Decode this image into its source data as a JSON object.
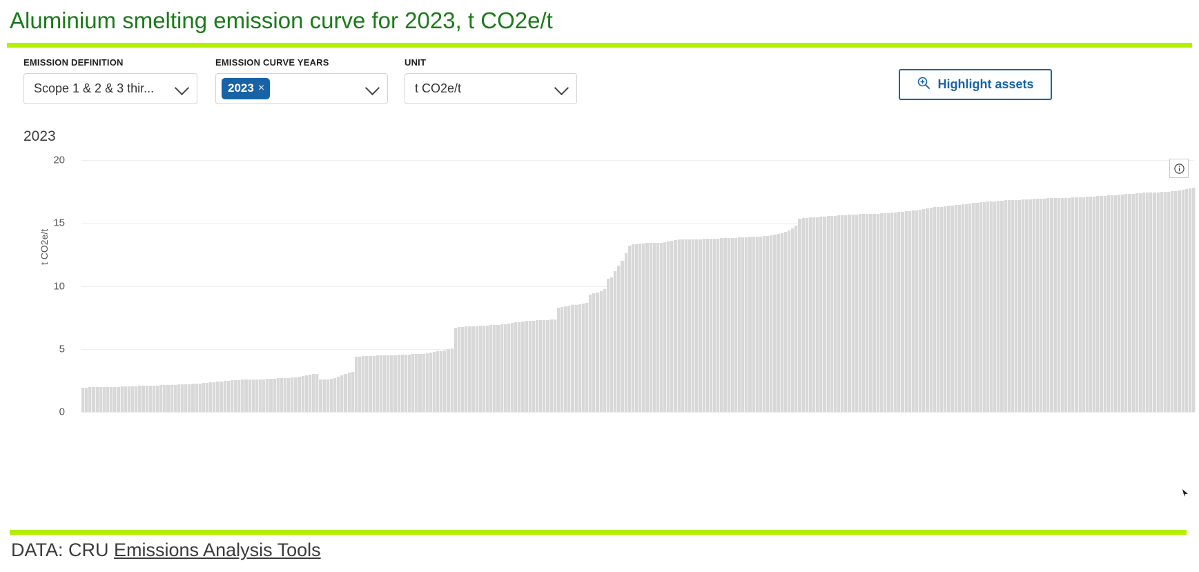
{
  "header": {
    "title": "Aluminium smelting emission curve for 2023, t CO2e/t",
    "title_color": "#1a7a1a",
    "rule_color": "#b2ef00"
  },
  "controls": {
    "emission_definition": {
      "label": "EMISSION DEFINITION",
      "value": "Scope 1 & 2 & 3 thir...",
      "chevron_icon": "chevron-down-icon"
    },
    "emission_curve_years": {
      "label": "EMISSION CURVE YEARS",
      "chip": "2023",
      "chip_remove": "×",
      "chip_color": "#1763a6",
      "chevron_icon": "chevron-down-icon"
    },
    "unit": {
      "label": "UNIT",
      "value": "t CO2e/t",
      "chevron_icon": "chevron-down-icon"
    },
    "highlight_button": {
      "label": "Highlight assets",
      "icon": "zoom-in-icon",
      "accent": "#1763a6"
    }
  },
  "chart_panel": {
    "subtitle": "2023",
    "info_icon": "info-icon"
  },
  "footer": {
    "prefix": "DATA: CRU ",
    "link": "Emissions Analysis Tools"
  },
  "chart_data": {
    "type": "bar",
    "title": "2023",
    "xlabel": "",
    "ylabel": "t CO2e/t",
    "ylim": [
      0,
      20
    ],
    "yticks": [
      0,
      5,
      10,
      15,
      20
    ],
    "grid": true,
    "legend": null,
    "bar_color": "#d8d8d8",
    "description": "Sorted ascending aluminium smelting emission intensity curve; each bar is one smelter asset.",
    "categories": [],
    "values": [
      1.9,
      1.9,
      1.95,
      1.95,
      1.95,
      2.0,
      2.0,
      2.0,
      2.0,
      2.0,
      2.0,
      2.05,
      2.05,
      2.05,
      2.05,
      2.05,
      2.1,
      2.1,
      2.1,
      2.1,
      2.1,
      2.1,
      2.15,
      2.15,
      2.15,
      2.15,
      2.15,
      2.2,
      2.2,
      2.2,
      2.2,
      2.25,
      2.25,
      2.25,
      2.3,
      2.3,
      2.35,
      2.35,
      2.4,
      2.4,
      2.45,
      2.45,
      2.5,
      2.5,
      2.5,
      2.55,
      2.55,
      2.55,
      2.6,
      2.6,
      2.6,
      2.6,
      2.65,
      2.65,
      2.65,
      2.7,
      2.7,
      2.7,
      2.7,
      2.75,
      2.75,
      2.8,
      2.85,
      2.9,
      2.95,
      3.0,
      3.0,
      2.6,
      2.6,
      2.6,
      2.65,
      2.7,
      2.8,
      2.9,
      3.0,
      3.1,
      3.2,
      4.4,
      4.4,
      4.45,
      4.45,
      4.45,
      4.45,
      4.5,
      4.5,
      4.5,
      4.5,
      4.5,
      4.5,
      4.55,
      4.55,
      4.55,
      4.55,
      4.6,
      4.6,
      4.6,
      4.6,
      4.65,
      4.7,
      4.75,
      4.8,
      4.85,
      4.9,
      5.0,
      5.05,
      6.7,
      6.75,
      6.75,
      6.8,
      6.8,
      6.8,
      6.8,
      6.85,
      6.85,
      6.85,
      6.9,
      6.9,
      6.9,
      6.95,
      6.95,
      7.0,
      7.05,
      7.1,
      7.15,
      7.2,
      7.25,
      7.25,
      7.25,
      7.3,
      7.3,
      7.3,
      7.3,
      7.35,
      7.35,
      8.3,
      8.35,
      8.4,
      8.45,
      8.5,
      8.5,
      8.55,
      8.6,
      8.65,
      9.3,
      9.4,
      9.5,
      9.6,
      9.75,
      10.6,
      10.7,
      11.2,
      11.6,
      12.0,
      12.6,
      13.2,
      13.3,
      13.3,
      13.35,
      13.35,
      13.4,
      13.4,
      13.4,
      13.4,
      13.45,
      13.5,
      13.55,
      13.6,
      13.65,
      13.7,
      13.7,
      13.7,
      13.7,
      13.7,
      13.7,
      13.7,
      13.75,
      13.75,
      13.75,
      13.75,
      13.75,
      13.8,
      13.8,
      13.8,
      13.8,
      13.8,
      13.85,
      13.85,
      13.85,
      13.9,
      13.9,
      13.9,
      13.9,
      13.95,
      14.0,
      14.05,
      14.1,
      14.15,
      14.2,
      14.3,
      14.4,
      14.6,
      14.8,
      15.35,
      15.4,
      15.4,
      15.45,
      15.45,
      15.45,
      15.5,
      15.5,
      15.55,
      15.55,
      15.55,
      15.6,
      15.6,
      15.6,
      15.65,
      15.65,
      15.65,
      15.7,
      15.7,
      15.7,
      15.75,
      15.75,
      15.75,
      15.8,
      15.8,
      15.8,
      15.85,
      15.85,
      15.9,
      15.9,
      15.95,
      15.95,
      16.0,
      16.0,
      16.05,
      16.1,
      16.15,
      16.2,
      16.25,
      16.3,
      16.3,
      16.35,
      16.4,
      16.4,
      16.45,
      16.45,
      16.5,
      16.5,
      16.55,
      16.6,
      16.6,
      16.65,
      16.65,
      16.7,
      16.7,
      16.7,
      16.75,
      16.75,
      16.8,
      16.8,
      16.85,
      16.85,
      16.85,
      16.9,
      16.9,
      16.9,
      16.95,
      16.95,
      16.95,
      16.95,
      17.0,
      17.0,
      17.0,
      17.0,
      17.0,
      17.0,
      17.0,
      17.05,
      17.05,
      17.05,
      17.05,
      17.1,
      17.1,
      17.1,
      17.15,
      17.15,
      17.15,
      17.2,
      17.2,
      17.2,
      17.25,
      17.25,
      17.3,
      17.3,
      17.3,
      17.35,
      17.35,
      17.4,
      17.4,
      17.4,
      17.45,
      17.45,
      17.5,
      17.5,
      17.5,
      17.55,
      17.55,
      17.6,
      17.65,
      17.7,
      17.75,
      17.8
    ]
  }
}
